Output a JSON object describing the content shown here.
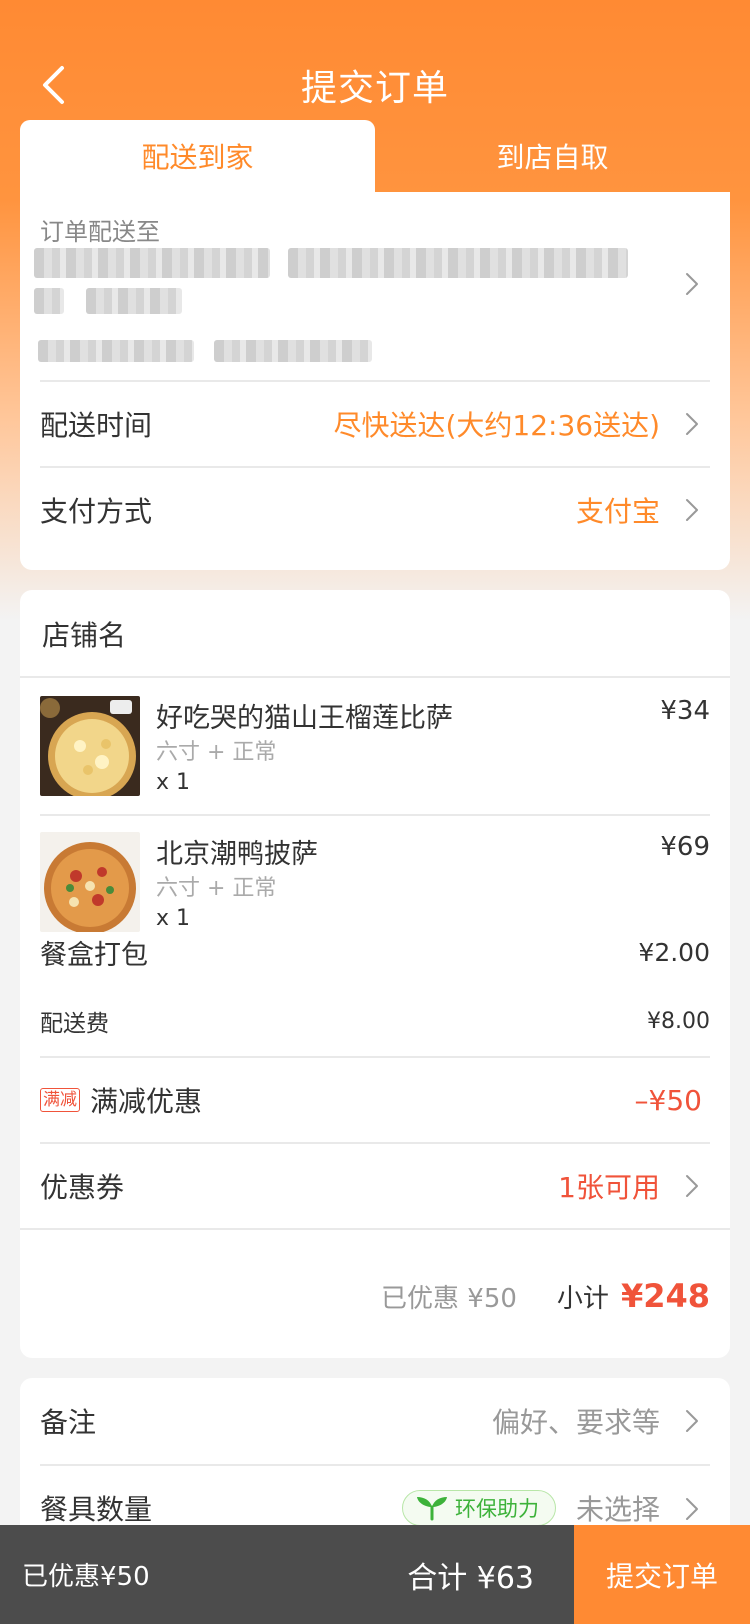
{
  "nav": {
    "title": "提交订单",
    "back_icon": "chevron-left-icon"
  },
  "tabs": [
    {
      "label": "配送到家",
      "active": true
    },
    {
      "label": "到店自取",
      "active": false
    }
  ],
  "delivery": {
    "address_label": "订单配送至",
    "time_label": "配送时间",
    "time_value": "尽快送达(大约12:36送达)",
    "payment_label": "支付方式",
    "payment_value": "支付宝"
  },
  "order": {
    "shop_name": "店铺名",
    "items": [
      {
        "name": "好吃哭的猫山王榴莲比萨",
        "spec": "六寸 + 正常",
        "qty": "x 1",
        "price": "¥34"
      },
      {
        "name": "北京潮鸭披萨",
        "spec": "六寸 + 正常",
        "qty": "x 1",
        "price": "¥69"
      }
    ],
    "packing_label": "餐盒打包",
    "packing_value": "¥2.00",
    "delivery_fee_label": "配送费",
    "delivery_fee_value": "¥8.00",
    "discount_tag": "满减",
    "discount_label": "满减优惠",
    "discount_value": "–¥50",
    "coupon_label": "优惠券",
    "coupon_value": "1张可用",
    "saved_text": "已优惠 ¥50",
    "subtotal_label": "小计",
    "subtotal_value": "¥248"
  },
  "extras": {
    "remark_label": "备注",
    "remark_placeholder": "偏好、要求等",
    "utensils_label": "餐具数量",
    "eco_tag": "环保助力",
    "utensils_value": "未选择"
  },
  "bottom": {
    "saved": "已优惠¥50",
    "total": "合计 ¥63",
    "submit": "提交订单"
  },
  "colors": {
    "accent": "#ff8a2a",
    "price_red": "#f0533a",
    "bar_dark": "#4c4c4c",
    "eco_green": "#3db23a"
  }
}
